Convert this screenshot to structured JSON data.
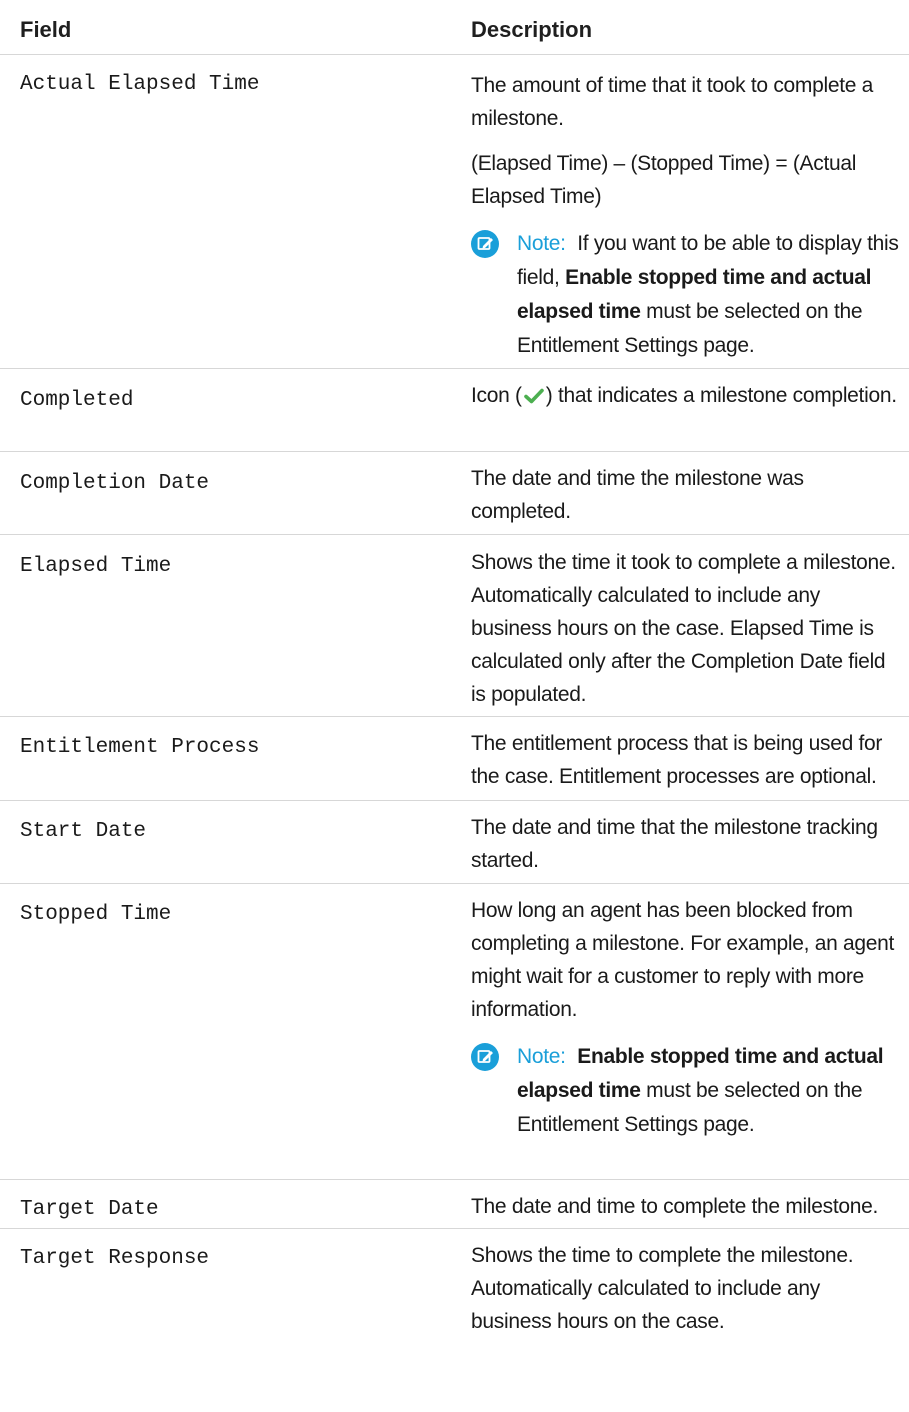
{
  "header": {
    "field": "Field",
    "description": "Description"
  },
  "rows": [
    {
      "field": "Actual Elapsed Time",
      "desc1": "The amount of time that it took to complete a milestone.",
      "desc2": "(Elapsed Time) – (Stopped Time) = (Actual Elapsed Time)",
      "note": {
        "label": "Note:",
        "before": "If you want to be able to display this field,",
        "bold": "Enable stopped time and actual elapsed time",
        "after": "must be selected on the Entitlement Settings page."
      }
    },
    {
      "field": "Completed",
      "desc_before": "Icon (",
      "desc_after": ") that indicates a milestone completion."
    },
    {
      "field": "Completion Date",
      "desc": "The date and time the milestone was completed."
    },
    {
      "field": "Elapsed Time",
      "desc": "Shows the time it took to complete a milestone. Automatically calculated to include any business hours on the case. Elapsed Time is calculated only after the Completion Date field is populated."
    },
    {
      "field": "Entitlement Process",
      "desc": "The entitlement process that is being used for the case. Entitlement processes are optional."
    },
    {
      "field": "Start Date",
      "desc": "The date and time that the milestone tracking started."
    },
    {
      "field": "Stopped Time",
      "desc": "How long an agent has been blocked from completing a milestone. For example, an agent might wait for a customer to reply with more information.",
      "note": {
        "label": "Note:",
        "bold": "Enable stopped time and actual elapsed time",
        "after": "must be selected on the Entitlement Settings page."
      }
    },
    {
      "field": "Target Date",
      "desc": "The date and time to complete the milestone."
    },
    {
      "field": "Target Response",
      "desc": "Shows the time to complete the milestone. Automatically calculated to include any business hours on the case."
    }
  ],
  "icons": {
    "note": "note-pencil-icon",
    "completed": "green-check-icon"
  },
  "colors": {
    "note_accent": "#1a9fd9",
    "check": "#4caf50",
    "divider": "#d7d7d7"
  }
}
